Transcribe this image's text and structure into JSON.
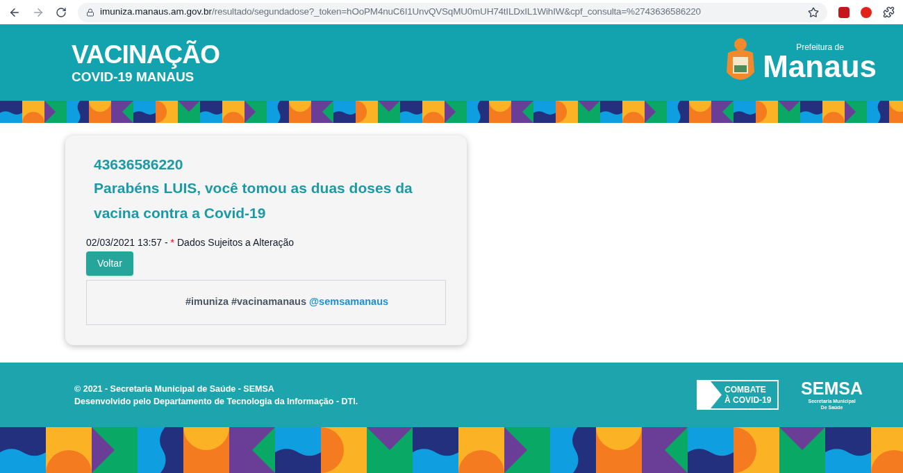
{
  "browser": {
    "url_host": "imuniza.manaus.am.gov.br",
    "url_path": "/resultado/segundadose?_token=hOoPM4nuC6I1UnvQVSqMU0mUH74tILDxIL1WihIW&cpf_consulta=%2743636586220"
  },
  "header": {
    "title": "VACINAÇÃO",
    "subtitle": "COVID-19 MANAUS",
    "logo_small": "Prefeitura de",
    "logo_big": "Manaus"
  },
  "result": {
    "cpf": "43636586220",
    "message": "Parabéns LUIS, você tomou as duas doses da vacina contra a Covid-19",
    "timestamp": "02/03/2021 13:57 -",
    "asterisk": "*",
    "note": "Dados Sujeitos a Alteração",
    "back_button": "Voltar",
    "hashtags": "#imuniza #vacinamanaus",
    "handle": "@semsamanaus"
  },
  "footer": {
    "lines": [
      "© 2021 - Secretaria Municipal de Saúde - SEMSA",
      "Desenvolvido pelo Departamento de Tecnologia da Informação - DTI."
    ],
    "combate_lines": [
      "COMBATE",
      "À COVID-19"
    ],
    "semsa": "SEMSA",
    "semsa_sub": [
      "Secretaria Municipal",
      "De Saúde"
    ]
  }
}
